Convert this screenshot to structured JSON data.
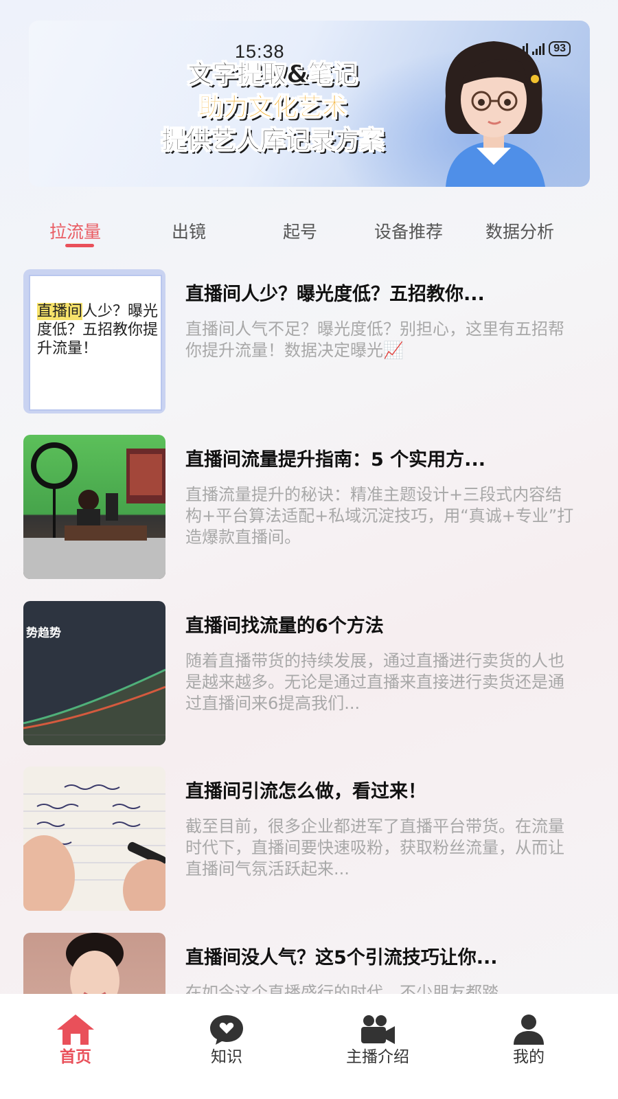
{
  "status_bar": {
    "time": "15:38",
    "network": "5G 4G",
    "battery": "93"
  },
  "banner": {
    "line1": "文字提取&笔记",
    "line2": "助力文化艺术",
    "line3": "提供艺人库记录方案"
  },
  "tabs": [
    "拉流量",
    "出镜",
    "起号",
    "设备推荐",
    "数据分析"
  ],
  "active_tab": "拉流量",
  "articles": [
    {
      "title": "直播间人少？曝光度低？五招教你...",
      "desc": "直播间人气不足？曝光度低？别担心，这里有五招帮你提升流量！数据决定曝光📈",
      "thumb_text_highlight": "直播间",
      "thumb_text_rest": "人少？曝光度低？五招教你提升流量！"
    },
    {
      "title": "直播间流量提升指南：5 个实用方...",
      "desc": "直播流量提升的秘诀：精准主题设计+三段式内容结构+平台算法适配+私域沉淀技巧，用“真诚+专业”打造爆款直播间。"
    },
    {
      "title": "直播间找流量的6个方法",
      "desc": "随着直播带货的持续发展，通过直播进行卖货的人也是越来越多。无论是通过直播来直接进行卖货还是通过直播间来6提高我们...",
      "thumb_label": "势趋势"
    },
    {
      "title": "直播间引流怎么做，看过来！",
      "desc": "截至目前，很多企业都进军了直播平台带货。在流量时代下，直播间要快速吸粉，获取粉丝流量，从而让直播间气氛活跃起来..."
    },
    {
      "title": "直播间没人气？这5个引流技巧让你...",
      "desc": "在如今这个直播盛行的时代，不少朋友都踏"
    }
  ],
  "bottom_nav": [
    {
      "label": "首页",
      "icon": "home-icon"
    },
    {
      "label": "知识",
      "icon": "chat-heart-icon"
    },
    {
      "label": "主播介绍",
      "icon": "video-camera-icon"
    },
    {
      "label": "我的",
      "icon": "user-icon"
    }
  ],
  "colors": {
    "accent": "#e9505a",
    "banner_highlight": "#f2a81d"
  }
}
